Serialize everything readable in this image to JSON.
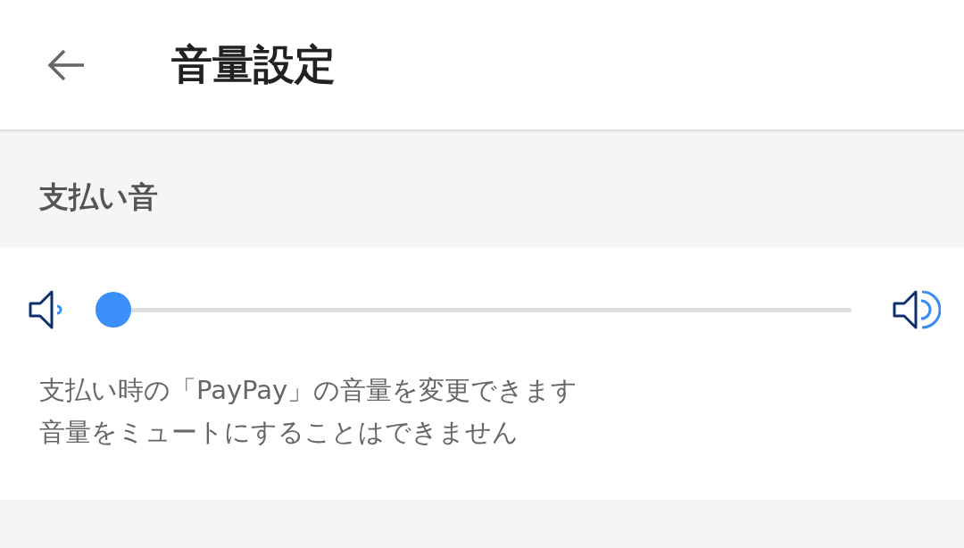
{
  "header": {
    "title": "音量設定"
  },
  "section": {
    "title": "支払い音"
  },
  "slider": {
    "level": 0
  },
  "description": [
    "支払い時の「PayPay」の音量を変更できます",
    "音量をミュートにすることはできません"
  ]
}
